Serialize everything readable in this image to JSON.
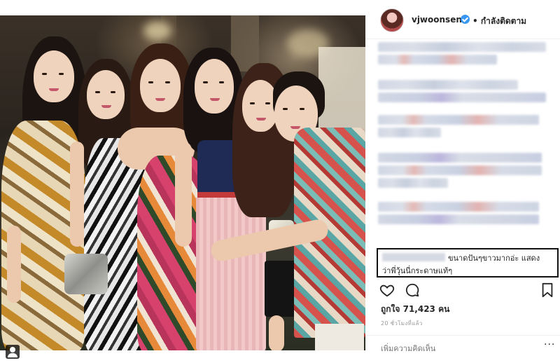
{
  "post": {
    "username": "vjwoonsen",
    "follow_state": "• กำลังติดตาม",
    "highlighted_comment": {
      "line1": "ขนาดปันๆขาวมากอ่ะ แสดง",
      "line2": "ว่าพี่วุ้นนี่กระดาษแท้ๆ"
    },
    "likes_text": "ถูกใจ 71,423 คน",
    "time_text": "20 ชั่วโมงที่แล้ว",
    "add_comment_placeholder": "เพิ่มความคิดเห็น",
    "more_label": "···"
  },
  "icons": {
    "like": "heart-outline-icon",
    "comment": "speech-bubble-icon",
    "save": "bookmark-icon",
    "photo_tag": "user-tag-icon",
    "verified": "verified-badge-icon"
  },
  "colors": {
    "verified_blue": "#3897f0",
    "text_primary": "#262626",
    "text_secondary": "#999999",
    "divider": "#efefef",
    "highlight_border": "#111111"
  }
}
